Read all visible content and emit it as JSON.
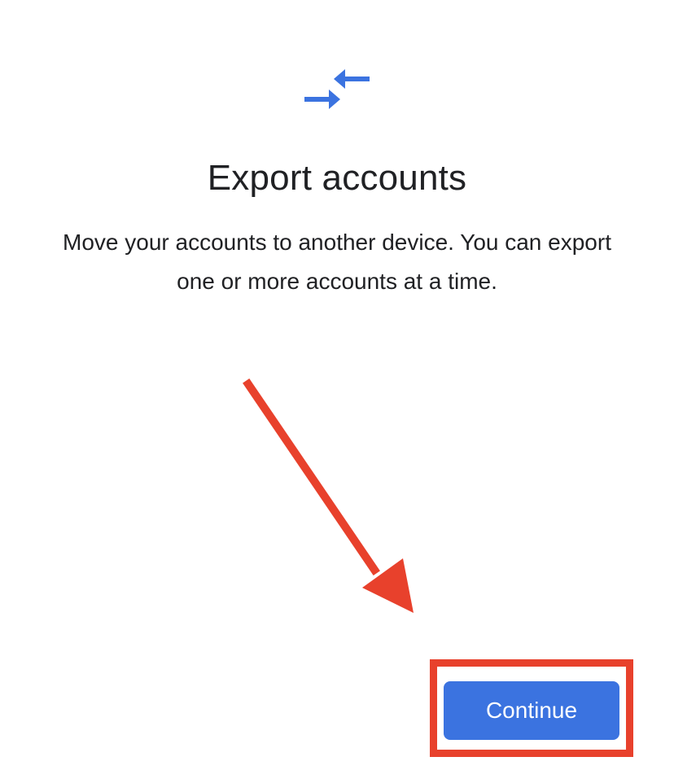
{
  "header": {
    "icon": "export-arrows-icon",
    "title": "Export accounts"
  },
  "body": {
    "description": "Move your accounts to another device. You can export one or more accounts at a time."
  },
  "actions": {
    "continue_label": "Continue"
  },
  "colors": {
    "accent_blue": "#3b73e0",
    "annotation_red": "#e8412c",
    "text": "#202124",
    "background": "#ffffff"
  }
}
